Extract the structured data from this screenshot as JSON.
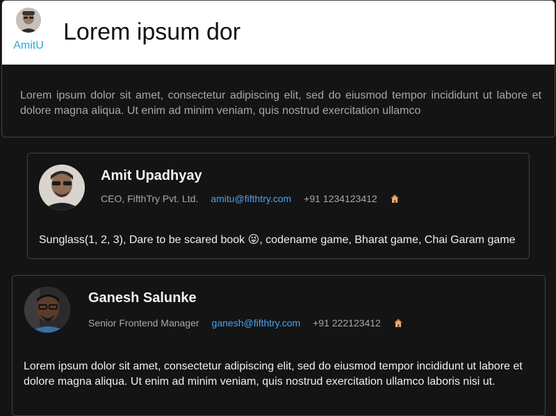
{
  "header": {
    "username": "AmitU",
    "title": "Lorem ipsum dor"
  },
  "intro": {
    "text": "Lorem ipsum dolor sit amet, consectetur adipiscing elit, sed do eiusmod tempor incididunt ut labore et dolore magna aliqua. Ut enim ad minim veniam, quis nostrud exercitation ullamco"
  },
  "people": [
    {
      "name": "Amit Upadhyay",
      "role": "CEO, FifthTry Pvt. Ltd.",
      "email": "amitu@fifthtry.com",
      "phone": "+91 1234123412",
      "bio": "Sunglass(1, 2, 3), Dare to be scared book 😜, codename game, Bharat game, Chai Garam game"
    },
    {
      "name": "Ganesh Salunke",
      "role": "Senior Frontend Manager",
      "email": "ganesh@fifthtry.com",
      "phone": "+91 222123412",
      "bio": "Lorem ipsum dolor sit amet, consectetur adipiscing elit, sed do eiusmod tempor incididunt ut labore et dolore magna aliqua. Ut enim ad minim veniam, quis nostrud exercitation ullamco laboris nisi ut."
    }
  ],
  "icons": {
    "home": "home-icon",
    "avatar": "avatar"
  },
  "colors": {
    "background": "#141414",
    "link": "#4aa3f0",
    "username": "#2ea8d6"
  }
}
